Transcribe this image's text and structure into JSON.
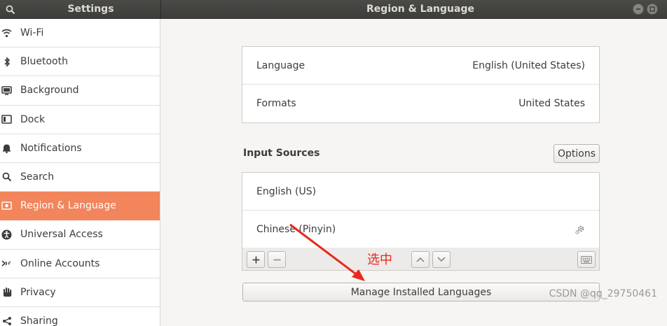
{
  "header": {
    "sidebar_title": "Settings",
    "main_title": "Region & Language"
  },
  "sidebar": {
    "items": [
      {
        "label": "Wi-Fi",
        "icon": "wifi-icon"
      },
      {
        "label": "Bluetooth",
        "icon": "bluetooth-icon"
      },
      {
        "label": "Background",
        "icon": "background-icon"
      },
      {
        "label": "Dock",
        "icon": "dock-icon"
      },
      {
        "label": "Notifications",
        "icon": "bell-icon"
      },
      {
        "label": "Search",
        "icon": "search-icon"
      },
      {
        "label": "Region & Language",
        "icon": "flag-icon",
        "active": true
      },
      {
        "label": "Universal Access",
        "icon": "accessibility-icon"
      },
      {
        "label": "Online Accounts",
        "icon": "online-accounts-icon"
      },
      {
        "label": "Privacy",
        "icon": "hand-icon"
      },
      {
        "label": "Sharing",
        "icon": "share-icon"
      }
    ]
  },
  "main": {
    "language_row": {
      "label": "Language",
      "value": "English (United States)"
    },
    "formats_row": {
      "label": "Formats",
      "value": "United States"
    },
    "input_sources_title": "Input Sources",
    "options_button": "Options",
    "input_sources": [
      {
        "label": "English (US)"
      },
      {
        "label": "Chinese (Pinyin)",
        "has_settings": true
      }
    ],
    "manage_button": "Manage Installed Languages"
  },
  "annotation": {
    "text": "选中",
    "color": "#e8291c"
  },
  "watermark": "CSDN @qq_29750461",
  "colors": {
    "accent": "#f2855c",
    "header": "#3d3d3a"
  }
}
